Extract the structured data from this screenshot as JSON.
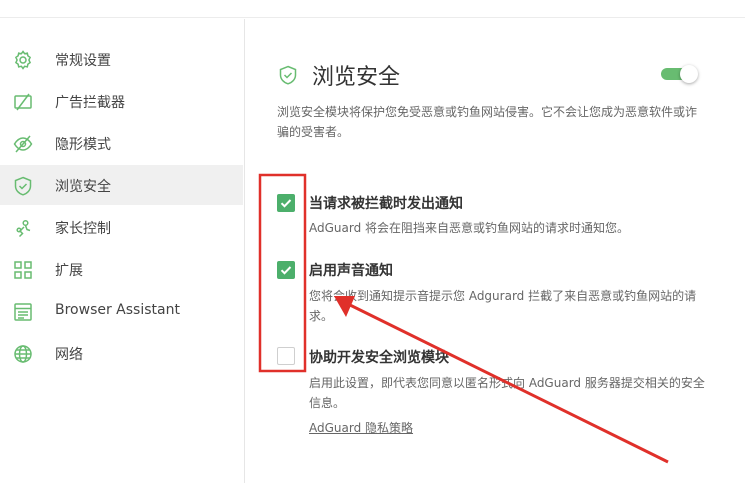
{
  "sidebar": {
    "items": [
      {
        "label": "常规设置",
        "icon": "gear-icon"
      },
      {
        "label": "广告拦截器",
        "icon": "ad-block-icon"
      },
      {
        "label": "隐形模式",
        "icon": "stealth-eye-icon"
      },
      {
        "label": "浏览安全",
        "icon": "shield-icon",
        "active": true
      },
      {
        "label": "家长控制",
        "icon": "parental-control-icon"
      },
      {
        "label": "扩展",
        "icon": "extensions-grid-icon"
      },
      {
        "label": "Browser Assistant",
        "icon": "browser-window-icon"
      },
      {
        "label": "网络",
        "icon": "globe-icon"
      }
    ]
  },
  "main": {
    "title": "浏览安全",
    "toggle_on": true,
    "description": "浏览安全模块将保护您免受恶意或钓鱼网站侵害。它不会让您成为恶意软件或诈骗的受害者。",
    "options": [
      {
        "title": "当请求被拦截时发出通知",
        "description": "AdGuard 将会在阻挡来自恶意或钓鱼网站的请求时通知您。",
        "checked": true
      },
      {
        "title": "启用声音通知",
        "description": "您将会收到通知提示音提示您 Adgurard 拦截了来自恶意或钓鱼网站的请求。",
        "checked": true
      },
      {
        "title": "协助开发安全浏览模块",
        "description": "启用此设置，即代表您同意以匿名形式向 AdGuard 服务器提交相关的安全信息。",
        "checked": false
      }
    ],
    "privacy_link": "AdGuard 隐私策略"
  },
  "colors": {
    "accent_green": "#68bc71",
    "checkbox_green": "#4caf6b",
    "annotation_red": "#e0302a"
  }
}
